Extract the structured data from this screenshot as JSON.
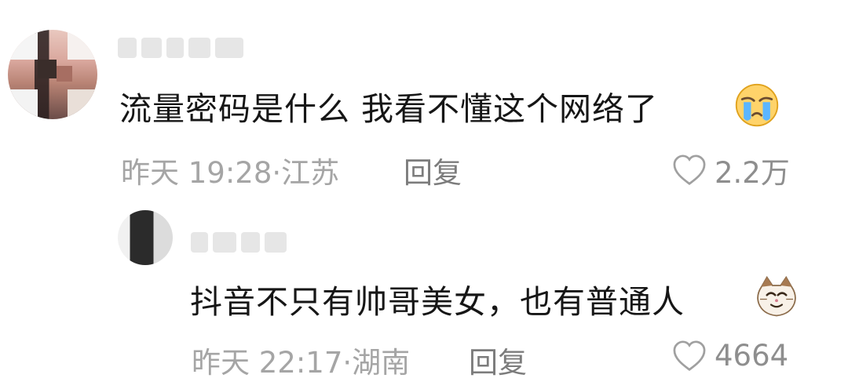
{
  "comments": [
    {
      "text": "流量密码是什么 我看不懂这个网络了",
      "emoji": "loudly-crying-face",
      "time": "昨天 19:28",
      "location": "江苏",
      "reply_label": "回复",
      "likes": "2.2万"
    },
    {
      "text": "抖音不只有帅哥美女，也有普通人",
      "emoji": "smirking-cat-face",
      "time": "昨天 22:17",
      "location": "湖南",
      "reply_label": "回复",
      "likes": "4664"
    }
  ],
  "separator": "·",
  "icons": {
    "like": "heart-outline-icon"
  },
  "colors": {
    "text_primary": "#161616",
    "text_meta": "#a5a5a5",
    "text_action": "#7c7c7c"
  }
}
